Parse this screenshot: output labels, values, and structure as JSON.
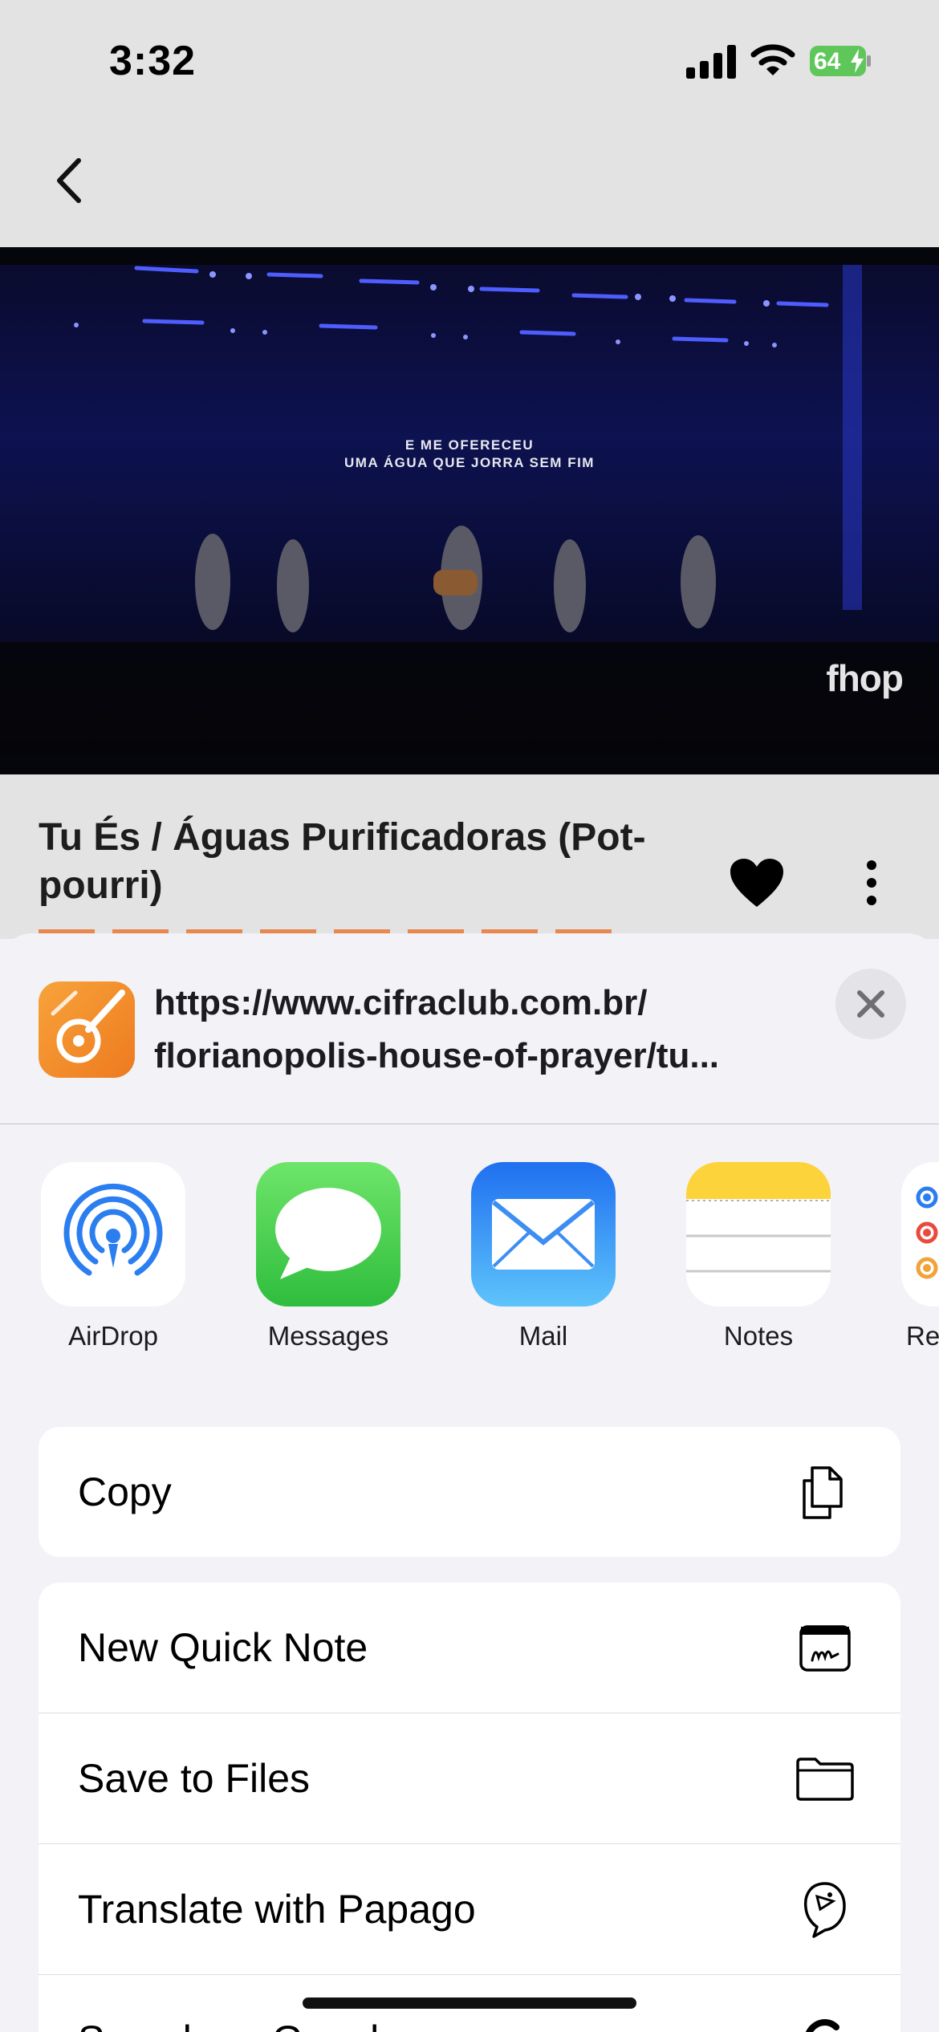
{
  "status_bar": {
    "time": "3:32",
    "battery": "64"
  },
  "video": {
    "lyric_line1": "E ME OFERECEU",
    "lyric_line2": "UMA ÁGUA QUE JORRA SEM FIM",
    "watermark": "fhop"
  },
  "song": {
    "title": "Tu És / Águas Purificadoras (Pot-pourri)"
  },
  "share_sheet": {
    "url_line1": "https://www.cifraclub.com.br/",
    "url_line2": "florianopolis-house-of-prayer/tu...",
    "apps": [
      {
        "label": "AirDrop",
        "icon": "airdrop-icon"
      },
      {
        "label": "Messages",
        "icon": "messages-icon"
      },
      {
        "label": "Mail",
        "icon": "mail-icon"
      },
      {
        "label": "Notes",
        "icon": "notes-icon"
      },
      {
        "label": "Re",
        "icon": "reminders-icon"
      }
    ],
    "copy_group": [
      {
        "label": "Copy",
        "icon": "copy-icon"
      }
    ],
    "actions": [
      {
        "label": "New Quick Note",
        "icon": "quick-note-icon"
      },
      {
        "label": "Save to Files",
        "icon": "folder-icon"
      },
      {
        "label": "Translate with Papago",
        "icon": "papago-icon"
      },
      {
        "label": "Search on Google",
        "icon": "google-icon"
      }
    ]
  },
  "colors": {
    "accent_orange": "#ee7a1f",
    "airdrop_blue": "#2b7ef0",
    "messages_green": "#4cd964",
    "mail_blue": "#2f8ef5",
    "notes_yellow": "#fcd33a"
  }
}
